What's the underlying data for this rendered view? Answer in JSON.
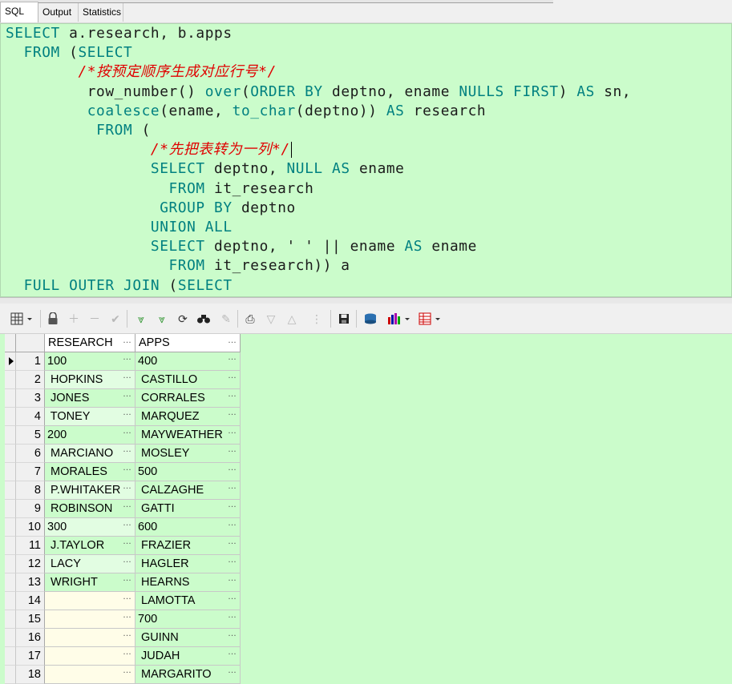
{
  "tabs": [
    {
      "label": "SQL",
      "active": true
    },
    {
      "label": "Output",
      "active": false
    },
    {
      "label": "Statistics",
      "active": false
    }
  ],
  "editor": {
    "lines": [
      "SELECT a.research, b.apps",
      "  FROM (SELECT",
      "        /*按预定顺序生成对应行号*/",
      "         row_number() over(ORDER BY deptno, ename NULLS FIRST) AS sn,",
      "         coalesce(ename, to_char(deptno)) AS research",
      "          FROM (",
      "                /*先把表转为一列*/",
      "                SELECT deptno, NULL AS ename",
      "                  FROM it_research",
      "                 GROUP BY deptno",
      "                UNION ALL",
      "                SELECT deptno, ' ' || ename AS ename",
      "                  FROM it_research)) a",
      "  FULL OUTER JOIN (SELECT"
    ]
  },
  "toolbar": {
    "icons": [
      "grid-menu-icon",
      "lock-icon",
      "add-record-icon",
      "delete-record-icon",
      "post-changes-icon",
      "fetch-next-icon",
      "fetch-last-icon",
      "refresh-icon",
      "find-icon",
      "clear-icon",
      "print-icon",
      "filter-down-icon",
      "filter-up-icon",
      "tree-icon",
      "save-icon",
      "export-icon",
      "chart-icon",
      "table-view-icon"
    ]
  },
  "grid": {
    "columns": [
      "RESEARCH",
      "APPS"
    ],
    "rows": [
      {
        "n": "1",
        "research": "100",
        "apps": "400"
      },
      {
        "n": "2",
        "research": " HOPKINS",
        "apps": " CASTILLO"
      },
      {
        "n": "3",
        "research": " JONES",
        "apps": " CORRALES"
      },
      {
        "n": "4",
        "research": " TONEY",
        "apps": " MARQUEZ"
      },
      {
        "n": "5",
        "research": "200",
        "apps": " MAYWEATHER"
      },
      {
        "n": "6",
        "research": " MARCIANO",
        "apps": " MOSLEY"
      },
      {
        "n": "7",
        "research": " MORALES",
        "apps": "500"
      },
      {
        "n": "8",
        "research": " P.WHITAKER",
        "apps": " CALZAGHE"
      },
      {
        "n": "9",
        "research": " ROBINSON",
        "apps": " GATTI"
      },
      {
        "n": "10",
        "research": "300",
        "apps": "600"
      },
      {
        "n": "11",
        "research": " J.TAYLOR",
        "apps": " FRAZIER"
      },
      {
        "n": "12",
        "research": " LACY",
        "apps": " HAGLER"
      },
      {
        "n": "13",
        "research": " WRIGHT",
        "apps": " HEARNS"
      },
      {
        "n": "14",
        "research": "",
        "apps": " LAMOTTA"
      },
      {
        "n": "15",
        "research": "",
        "apps": "700"
      },
      {
        "n": "16",
        "research": "",
        "apps": " GUINN"
      },
      {
        "n": "17",
        "research": "",
        "apps": " JUDAH"
      },
      {
        "n": "18",
        "research": "",
        "apps": " MARGARITO"
      }
    ]
  }
}
